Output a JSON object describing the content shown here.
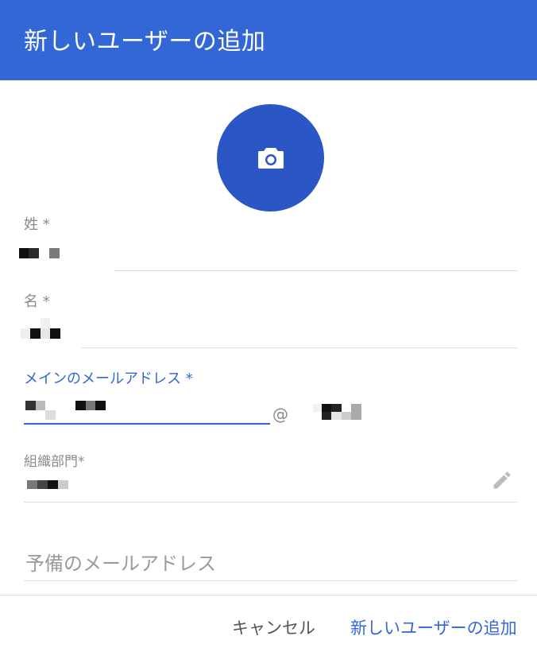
{
  "header": {
    "title": "新しいユーザーの追加"
  },
  "avatar": {
    "icon": "camera-icon",
    "color": "#2a56c6"
  },
  "fields": {
    "last_name": {
      "label": "姓 *"
    },
    "first_name": {
      "label": "名 *"
    },
    "primary_email": {
      "label": "メインのメールアドレス *",
      "at_sign": "@"
    },
    "org_unit": {
      "label": "組織部門*",
      "edit_icon": "pencil-icon"
    },
    "secondary_email": {
      "placeholder": "予備のメールアドレス"
    }
  },
  "actions": {
    "cancel_label": "キャンセル",
    "add_label": "新しいユーザーの追加"
  },
  "colors": {
    "accent": "#3367d6",
    "label": "#8a8a8a",
    "divider": "#dcdcdc"
  }
}
